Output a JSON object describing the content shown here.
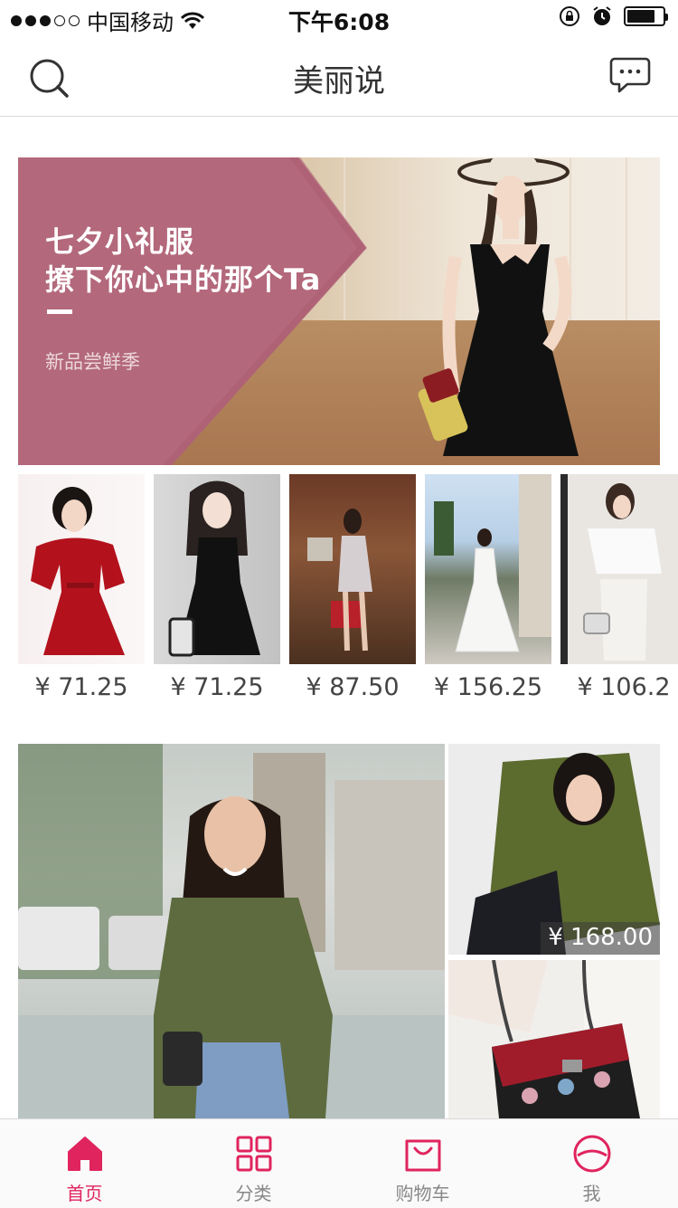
{
  "status_bar": {
    "carrier": "中国移动",
    "time": "下午6:08"
  },
  "nav": {
    "title": "美丽说",
    "search_icon": "search-icon",
    "message_icon": "message-icon"
  },
  "banner": {
    "line1": "七夕小礼服",
    "line2": "撩下你心中的那个Ta",
    "subtitle": "新品尝鲜季",
    "accent_color": "#b3687b"
  },
  "products": [
    {
      "price": "¥ 71.25"
    },
    {
      "price": "¥ 71.25"
    },
    {
      "price": "¥ 87.50"
    },
    {
      "price": "¥ 156.25"
    },
    {
      "price": "¥ 106.2"
    }
  ],
  "featured": {
    "top_right_price": "¥ 168.00"
  },
  "tabs": [
    {
      "label": "首页",
      "icon": "home-icon",
      "active": true
    },
    {
      "label": "分类",
      "icon": "grid-icon",
      "active": false
    },
    {
      "label": "购物车",
      "icon": "shopping-bag-icon",
      "active": false
    },
    {
      "label": "我",
      "icon": "profile-icon",
      "active": false
    }
  ],
  "colors": {
    "brand": "#e0245e"
  }
}
